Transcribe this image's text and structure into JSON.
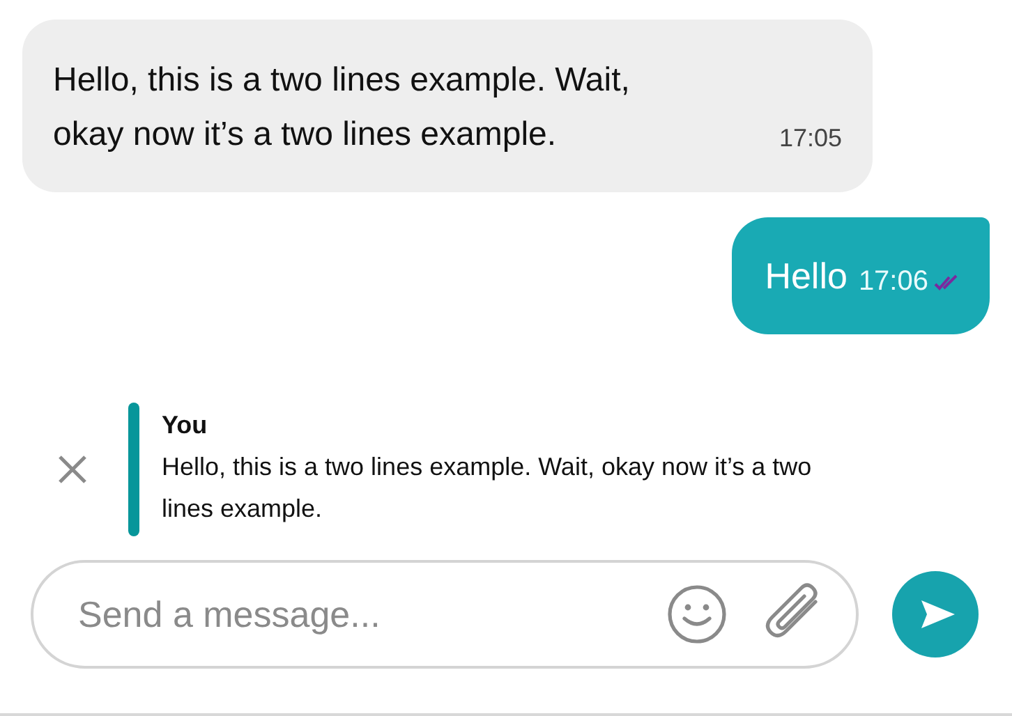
{
  "messages": [
    {
      "kind": "incoming",
      "text": "Hello, this is a two lines example. Wait, okay now it’s a two lines example.",
      "time": "17:05"
    },
    {
      "kind": "outgoing",
      "text": "Hello",
      "time": "17:06",
      "read": true
    }
  ],
  "reply_preview": {
    "author": "You",
    "text": "Hello, this is a two lines example. Wait, okay now it’s a two lines example."
  },
  "composer": {
    "placeholder": "Send a message..."
  }
}
